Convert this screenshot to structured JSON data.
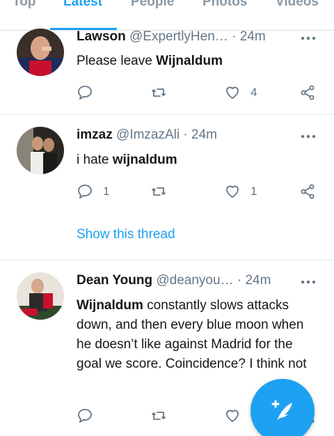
{
  "tabs": [
    {
      "label": "Top",
      "active": false
    },
    {
      "label": "Latest",
      "active": true
    },
    {
      "label": "People",
      "active": false
    },
    {
      "label": "Photos",
      "active": false
    },
    {
      "label": "Videos",
      "active": false
    }
  ],
  "tweets": [
    {
      "name": "Lawson",
      "handle": "@ExpertlyHen…",
      "dot": "·",
      "time": "24m",
      "text_prefix": "Please leave ",
      "text_bold": "Wijnaldum",
      "text_suffix": "",
      "reply_count": "",
      "retweet_count": "",
      "like_count": "4"
    },
    {
      "name": "imzaz",
      "handle": "@ImzazAli",
      "dot": "·",
      "time": "24m",
      "text_prefix": "i hate ",
      "text_bold": "wijnaldum",
      "text_suffix": "",
      "reply_count": "1",
      "retweet_count": "",
      "like_count": "1",
      "thread_link": "Show this thread"
    },
    {
      "name": "Dean Young",
      "handle": "@deanyou…",
      "dot": "·",
      "time": "24m",
      "text_prefix": "",
      "text_bold": "Wijnaldum",
      "text_suffix": " constantly slows attacks down, and then every blue moon when he doesn’t like against Madrid for the goal we score. Coincidence? I think not",
      "reply_count": "",
      "retweet_count": "",
      "like_count": ""
    }
  ],
  "colors": {
    "accent": "#1da1f2",
    "secondary_text": "#657786",
    "primary_text": "#14171a",
    "divider": "#e1e8ed"
  },
  "icons": {
    "reply": "speech-bubble-icon",
    "retweet": "retweet-icon",
    "like": "heart-icon",
    "share": "share-icon",
    "more": "more-dots-icon",
    "compose": "compose-feather-icon"
  }
}
